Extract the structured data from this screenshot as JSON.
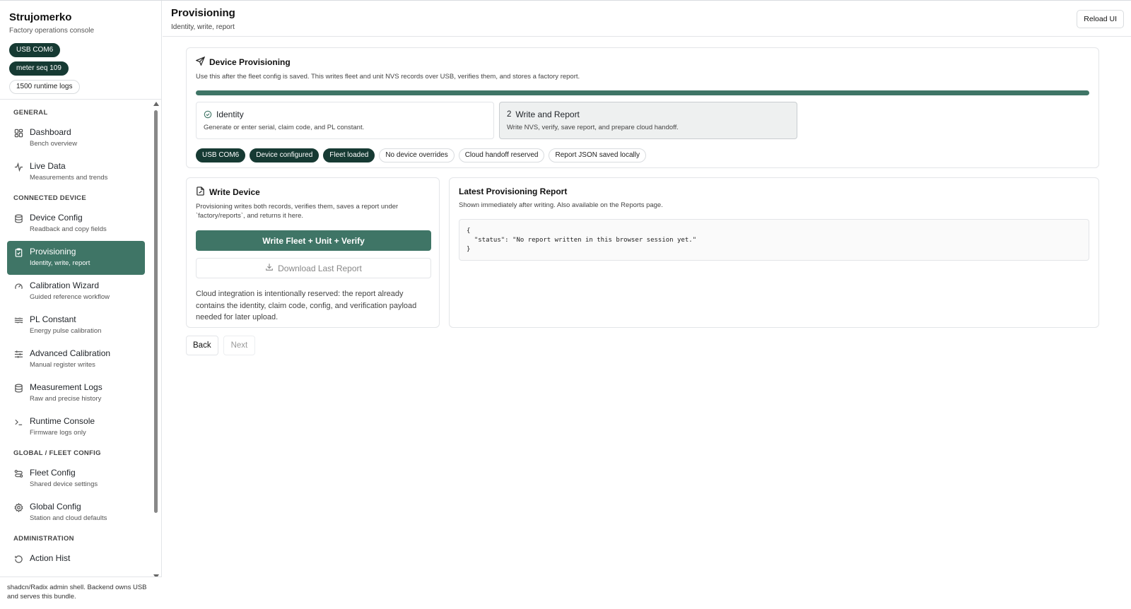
{
  "sidebar": {
    "brand_title": "Strujomerko",
    "brand_subtitle": "Factory operations console",
    "pills": [
      "USB COM6",
      "meter seq 109",
      "1500 runtime logs"
    ],
    "sections": {
      "general": "GENERAL",
      "connected": "CONNECTED DEVICE",
      "fleet": "GLOBAL / FLEET CONFIG",
      "admin": "ADMINISTRATION"
    },
    "items": [
      {
        "label": "Dashboard",
        "sub": "Bench overview",
        "icon": "grid-icon"
      },
      {
        "label": "Live Data",
        "sub": "Measurements and trends",
        "icon": "activity-icon"
      },
      {
        "label": "Device Config",
        "sub": "Readback and copy fields",
        "icon": "database-icon"
      },
      {
        "label": "Provisioning",
        "sub": "Identity, write, report",
        "icon": "clipboard-check-icon"
      },
      {
        "label": "Calibration Wizard",
        "sub": "Guided reference workflow",
        "icon": "gauge-icon"
      },
      {
        "label": "PL Constant",
        "sub": "Energy pulse calibration",
        "icon": "waves-icon"
      },
      {
        "label": "Advanced Calibration",
        "sub": "Manual register writes",
        "icon": "sliders-icon"
      },
      {
        "label": "Measurement Logs",
        "sub": "Raw and precise history",
        "icon": "database-icon"
      },
      {
        "label": "Runtime Console",
        "sub": "Firmware logs only",
        "icon": "terminal-icon"
      },
      {
        "label": "Fleet Config",
        "sub": "Shared device settings",
        "icon": "route-icon"
      },
      {
        "label": "Global Config",
        "sub": "Station and cloud defaults",
        "icon": "gear-icon"
      },
      {
        "label": "Action Hist",
        "sub": "",
        "icon": "history-icon"
      }
    ],
    "footer": "shadcn/Radix admin shell. Backend owns USB and serves this bundle."
  },
  "header": {
    "title": "Provisioning",
    "subtitle": "Identity, write, report",
    "reload_label": "Reload UI"
  },
  "provisioning": {
    "title": "Device Provisioning",
    "description": "Use this after the fleet config is saved. This writes fleet and unit NVS records over USB, verifies them, and stores a factory report.",
    "progress": 1.0,
    "steps": [
      {
        "number": "",
        "title": "Identity",
        "description": "Generate or enter serial, claim code, and PL constant.",
        "state": "done"
      },
      {
        "number": "2",
        "title": "Write and Report",
        "description": "Write NVS, verify, save report, and prepare cloud handoff.",
        "state": "current"
      }
    ],
    "chips": [
      {
        "label": "USB COM6",
        "style": "dark"
      },
      {
        "label": "Device configured",
        "style": "dark"
      },
      {
        "label": "Fleet loaded",
        "style": "dark"
      },
      {
        "label": "No device overrides",
        "style": "light"
      },
      {
        "label": "Cloud handoff reserved",
        "style": "light"
      },
      {
        "label": "Report JSON saved locally",
        "style": "light"
      }
    ]
  },
  "write_device": {
    "title": "Write Device",
    "description": "Provisioning writes both records, verifies them, saves a report under `factory/reports`, and returns it here.",
    "primary_label": "Write Fleet + Unit + Verify",
    "download_label": "Download Last Report",
    "note": "Cloud integration is intentionally reserved: the report already contains the identity, claim code, config, and verification payload needed for later upload."
  },
  "report": {
    "title": "Latest Provisioning Report",
    "description": "Shown immediately after writing. Also available on the Reports page.",
    "code": "{\n  \"status\": \"No report written in this browser session yet.\"\n}"
  },
  "footer_nav": {
    "back_label": "Back",
    "next_label": "Next"
  },
  "colors": {
    "accent": "#3f7566",
    "dark_chip": "#163a33"
  }
}
